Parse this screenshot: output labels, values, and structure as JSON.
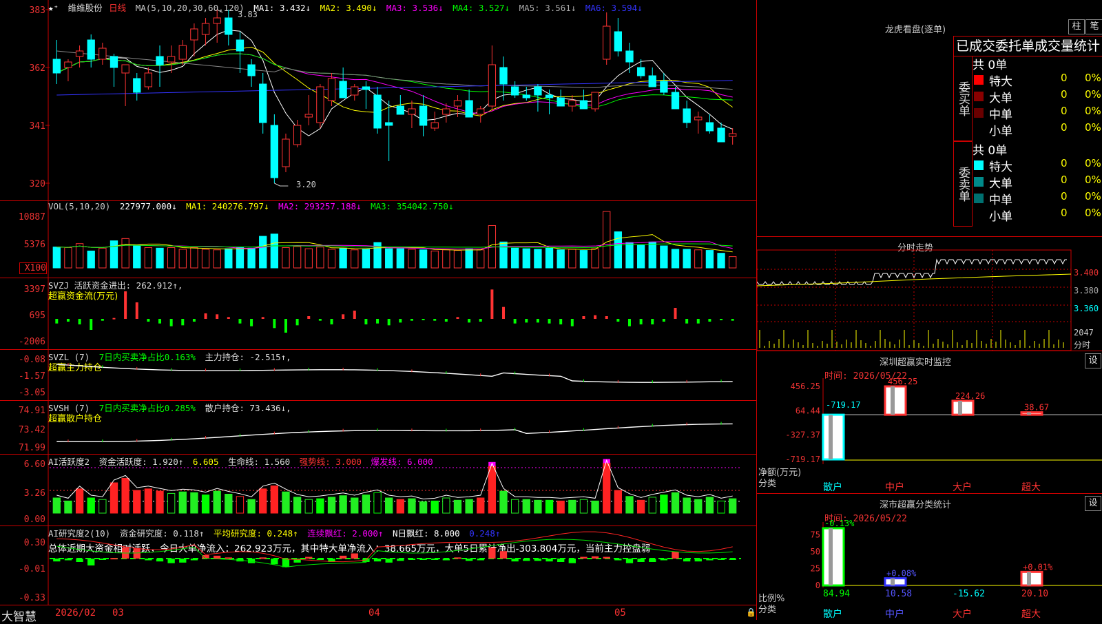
{
  "stock": {
    "name": "维维股份",
    "period": "日线"
  },
  "ma_line": {
    "label": "MA(5,10,20,30,60,120)",
    "ma1": "MA1: 3.432↓",
    "ma2": "MA2: 3.490↓",
    "ma3": "MA3: 3.536↓",
    "ma4": "MA4: 3.527↓",
    "ma5": "MA5: 3.561↓",
    "ma6": "MA6: 3.594↓"
  },
  "price_axis": [
    "383",
    "362",
    "341",
    "320"
  ],
  "price_marks": {
    "high": "3.83",
    "low": "3.20"
  },
  "vol_line": {
    "label": "VOL(5,10,20)",
    "val": "227977.000↓",
    "ma1": "MA1: 240276.797↓",
    "ma2": "MA2: 293257.188↓",
    "ma3": "MA3: 354042.750↓"
  },
  "vol_axis": [
    "10887",
    "5376",
    "X100"
  ],
  "svzj": {
    "label": "SVZJ  活跃资金进出: 262.912↑,",
    "sub": "超赢资金流(万元)",
    "axis": [
      "3397",
      "695",
      "-2006"
    ]
  },
  "svzl": {
    "label": "SVZL (7)",
    "pct": "7日内买卖净占比0.163%",
    "hold": "主力持仓: -2.515↑,",
    "sub": "超赢主力持仓",
    "axis": [
      "-0.08",
      "-1.57",
      "-3.05"
    ]
  },
  "svsh": {
    "label": "SVSH (7)",
    "pct": "7日内买卖净占比0.285%",
    "hold": "散户持仓: 73.436↓,",
    "sub": "超赢散户持仓",
    "axis": [
      "74.91",
      "73.42",
      "71.99"
    ]
  },
  "ai1": {
    "label": "AI活跃度2",
    "a": "资金活跃度: 1.920↑",
    "b": "6.605",
    "c": "生命线: 1.560",
    "d": "强势线: 3.000",
    "e": "爆发线: 6.000",
    "axis": [
      "6.60",
      "3.26",
      "0.00"
    ]
  },
  "ai2": {
    "label": "AI研究度2(10)",
    "a": "资金研究度: 0.118↑",
    "b": "平均研究度: 0.248↑",
    "c": "连续飘红: 2.000↑",
    "d": "N日飘红: 8.000",
    "e": "0.248↑",
    "summary": "总体近期大资金相对活跃，今日大单净流入：262.923万元，其中特大单净流入：38.665万元，大单5日累计净出-303.804万元，当前主力控盘弱",
    "axis": [
      "0.30",
      "-0.01",
      "-0.33"
    ]
  },
  "bottom": {
    "app": "大智慧",
    "date": "2026/02",
    "m1": "03",
    "m2": "04",
    "m3": "05"
  },
  "lhb": {
    "title": "龙虎看盘(逐单)",
    "btn1": "柱",
    "btn2": "笔",
    "heading": "已成交委托单成交量统计",
    "buy_label": "委买单",
    "sell_label": "委卖单",
    "buy_total": "共 0单",
    "sell_total": "共 0单",
    "buy_rows": [
      {
        "name": "特大",
        "n": "0",
        "p": "0%",
        "color": "#ff0000"
      },
      {
        "name": "大单",
        "n": "0",
        "p": "0%",
        "color": "#8b0000"
      },
      {
        "name": "中单",
        "n": "0",
        "p": "0%",
        "color": "#6a0000"
      },
      {
        "name": "小单",
        "n": "0",
        "p": "0%",
        "color": "#000000"
      }
    ],
    "sell_rows": [
      {
        "name": "特大",
        "n": "0",
        "p": "0%",
        "color": "#00ffff"
      },
      {
        "name": "大单",
        "n": "0",
        "p": "0%",
        "color": "#008b8b"
      },
      {
        "name": "中单",
        "n": "0",
        "p": "0%",
        "color": "#007070"
      },
      {
        "name": "小单",
        "n": "0",
        "p": "0%",
        "color": "#000000"
      }
    ]
  },
  "fenshi": {
    "title": "分时走势",
    "axis": [
      "3.400",
      "3.380",
      "3.360"
    ],
    "vol": "2047",
    "label": "分时"
  },
  "sz_monitor": {
    "title": "深圳超赢实时监控",
    "btn": "设",
    "time": "时间: 2026/05/22",
    "axis": [
      "456.25",
      "64.44",
      "-327.37",
      "-719.17"
    ],
    "ylab": "净额(万元)",
    "xlab": "分类",
    "cats": [
      "散户",
      "中户",
      "大户",
      "超大"
    ],
    "values": [
      -719.17,
      456.25,
      224.26,
      38.67
    ],
    "labels": [
      "-719.17",
      "456.25",
      "224.26",
      "38.67"
    ]
  },
  "sz_class": {
    "title": "深市超赢分类统计",
    "btn": "设",
    "time": "时间: 2026/05/22",
    "axis": [
      "75",
      "50",
      "25",
      "0"
    ],
    "ylab": "比例%",
    "xlab": "分类",
    "cats": [
      "散户",
      "中户",
      "大户",
      "超大"
    ],
    "values": [
      84.94,
      10.58,
      -15.62,
      20.1
    ],
    "labels": [
      "84.94",
      "10.58",
      "-15.62",
      "20.10"
    ],
    "deltas": [
      "-0.13%",
      "+0.08%",
      "",
      "+0.01%"
    ]
  },
  "colors": {
    "up": "#ff3333",
    "down": "#00ffff",
    "grid": "#cc0000",
    "ma1": "#ffffff",
    "ma2": "#ffff00",
    "ma3": "#ff00ff",
    "ma4": "#00ff00",
    "ma5": "#888888",
    "ma6": "#3333ff"
  },
  "chart_data": {
    "type": "candlestick",
    "title": "维维股份 日线",
    "candles": [
      [
        3.65,
        3.72,
        3.56,
        3.6
      ],
      [
        3.62,
        3.65,
        3.57,
        3.64
      ],
      [
        3.66,
        3.7,
        3.62,
        3.68
      ],
      [
        3.72,
        3.74,
        3.62,
        3.65
      ],
      [
        3.65,
        3.71,
        3.63,
        3.69
      ],
      [
        3.66,
        3.67,
        3.55,
        3.62
      ],
      [
        3.6,
        3.63,
        3.48,
        3.63
      ],
      [
        3.58,
        3.6,
        3.5,
        3.53
      ],
      [
        3.55,
        3.62,
        3.54,
        3.6
      ],
      [
        3.66,
        3.7,
        3.55,
        3.63
      ],
      [
        3.64,
        3.7,
        3.6,
        3.66
      ],
      [
        3.65,
        3.72,
        3.63,
        3.7
      ],
      [
        3.72,
        3.78,
        3.66,
        3.76
      ],
      [
        3.74,
        3.8,
        3.7,
        3.78
      ],
      [
        3.78,
        3.83,
        3.71,
        3.8
      ],
      [
        3.8,
        3.83,
        3.7,
        3.74
      ],
      [
        3.72,
        3.75,
        3.6,
        3.68
      ],
      [
        3.63,
        3.65,
        3.55,
        3.59
      ],
      [
        3.56,
        3.6,
        3.38,
        3.42
      ],
      [
        3.41,
        3.45,
        3.2,
        3.22
      ],
      [
        3.26,
        3.38,
        3.24,
        3.36
      ],
      [
        3.34,
        3.43,
        3.33,
        3.41
      ],
      [
        3.44,
        3.52,
        3.41,
        3.45
      ],
      [
        3.42,
        3.56,
        3.4,
        3.55
      ],
      [
        3.5,
        3.6,
        3.48,
        3.58
      ],
      [
        3.57,
        3.62,
        3.52,
        3.51
      ],
      [
        3.52,
        3.56,
        3.5,
        3.55
      ],
      [
        3.55,
        3.57,
        3.47,
        3.54
      ],
      [
        3.52,
        3.55,
        3.38,
        3.4
      ],
      [
        3.42,
        3.5,
        3.28,
        3.41
      ],
      [
        3.48,
        3.52,
        3.46,
        3.45
      ],
      [
        3.45,
        3.5,
        3.4,
        3.47
      ],
      [
        3.48,
        3.52,
        3.37,
        3.41
      ],
      [
        3.4,
        3.46,
        3.39,
        3.42
      ],
      [
        3.45,
        3.49,
        3.42,
        3.47
      ],
      [
        3.48,
        3.52,
        3.44,
        3.5
      ],
      [
        3.5,
        3.54,
        3.47,
        3.44
      ],
      [
        3.45,
        3.48,
        3.42,
        3.47
      ],
      [
        3.48,
        3.7,
        3.46,
        3.63
      ],
      [
        3.62,
        3.66,
        3.5,
        3.56
      ],
      [
        3.55,
        3.57,
        3.51,
        3.52
      ],
      [
        3.52,
        3.55,
        3.5,
        3.51
      ],
      [
        3.55,
        3.56,
        3.46,
        3.52
      ],
      [
        3.52,
        3.54,
        3.45,
        3.51
      ],
      [
        3.51,
        3.54,
        3.48,
        3.48
      ],
      [
        3.48,
        3.52,
        3.46,
        3.5
      ],
      [
        3.5,
        3.54,
        3.48,
        3.47
      ],
      [
        3.47,
        3.51,
        3.46,
        3.53
      ],
      [
        3.65,
        3.82,
        3.63,
        3.77
      ],
      [
        3.75,
        3.8,
        3.66,
        3.68
      ],
      [
        3.68,
        3.71,
        3.6,
        3.64
      ],
      [
        3.62,
        3.65,
        3.58,
        3.59
      ],
      [
        3.59,
        3.62,
        3.55,
        3.55
      ],
      [
        3.57,
        3.6,
        3.52,
        3.53
      ],
      [
        3.53,
        3.55,
        3.48,
        3.47
      ],
      [
        3.47,
        3.5,
        3.4,
        3.42
      ],
      [
        3.43,
        3.46,
        3.38,
        3.44
      ],
      [
        3.42,
        3.45,
        3.38,
        3.39
      ],
      [
        3.4,
        3.42,
        3.36,
        3.35
      ],
      [
        3.37,
        3.4,
        3.34,
        3.38
      ]
    ],
    "volume": [
      3.7,
      3.6,
      4.3,
      3.0,
      3.5,
      4.8,
      5.2,
      4.0,
      3.6,
      3.5,
      3.6,
      3.3,
      3.6,
      3.3,
      3.2,
      3.4,
      3.6,
      3.5,
      5.6,
      6.0,
      3.6,
      3.8,
      3.4,
      3.7,
      3.3,
      3.5,
      3.2,
      3.3,
      4.5,
      3.4,
      3.4,
      3.3,
      3.2,
      3.0,
      3.2,
      3.1,
      3.4,
      3.2,
      7.5,
      4.6,
      3.5,
      3.4,
      3.3,
      3.5,
      3.2,
      3.3,
      3.1,
      3.4,
      10.0,
      6.4,
      4.5,
      4.0,
      4.6,
      3.9,
      3.3,
      3.3,
      3.2,
      3.1,
      2.6,
      2.0
    ],
    "svzj": [
      -500,
      -300,
      -600,
      -1200,
      -200,
      100,
      3000,
      1800,
      -300,
      -500,
      -800,
      -700,
      -300,
      600,
      500,
      200,
      -500,
      -800,
      200,
      -1000,
      -1500,
      -700,
      300,
      -200,
      -600,
      500,
      900,
      -600,
      -500,
      -700,
      -400,
      -200,
      -100,
      -200,
      -300,
      200,
      -400,
      -300,
      3200,
      1300,
      -500,
      -400,
      -400,
      -500,
      -600,
      -800,
      300,
      400,
      300,
      -300,
      -800,
      -600,
      -600,
      -300,
      1200,
      -500,
      -500,
      -300,
      -100,
      -200
    ],
    "ai_activity": [
      2.0,
      1.6,
      3.2,
      2.0,
      1.8,
      4.0,
      4.6,
      3.0,
      3.2,
      2.9,
      2.6,
      2.8,
      2.7,
      2.4,
      2.9,
      2.5,
      2.2,
      1.8,
      3.2,
      3.6,
      2.8,
      2.1,
      1.8,
      1.9,
      2.1,
      2.3,
      2.0,
      2.4,
      2.7,
      2.0,
      1.8,
      1.9,
      1.5,
      1.6,
      2.0,
      1.7,
      1.8,
      2.0,
      6.2,
      2.9,
      1.8,
      1.8,
      1.7,
      1.7,
      1.6,
      1.7,
      1.8,
      1.6,
      6.6,
      3.0,
      2.2,
      1.7,
      2.1,
      2.4,
      2.7,
      2.0,
      1.8,
      2.1,
      1.6,
      1.9
    ]
  }
}
